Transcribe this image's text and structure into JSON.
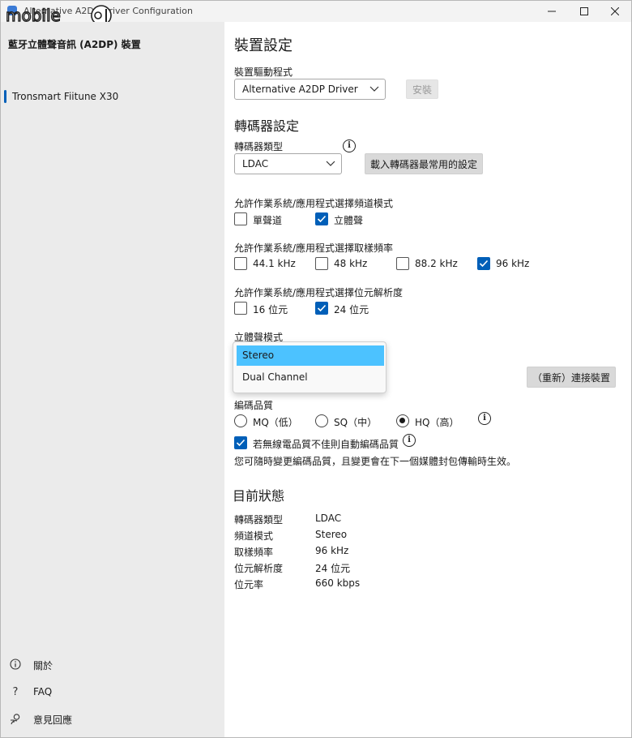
{
  "window": {
    "title": "Alternative A2DP Driver Configuration"
  },
  "sidebar": {
    "title": "藍牙立體聲音訊 (A2DP) 裝置",
    "device": "Tronsmart Fiitune X30",
    "links": [
      {
        "icon": "info-icon",
        "label": "關於"
      },
      {
        "icon": "question-icon",
        "label": "FAQ"
      },
      {
        "icon": "feedback-icon",
        "label": "意見回應"
      }
    ]
  },
  "main": {
    "device_settings_heading": "裝置設定",
    "driver_label": "裝置驅動程式",
    "driver_value": "Alternative A2DP Driver",
    "install_button": "安裝",
    "codec_settings_heading": "轉碼器設定",
    "codec_type_label": "轉碼器類型",
    "codec_type_value": "LDAC",
    "load_common_button": "載入轉碼器最常用的設定",
    "channel_mode_label": "允許作業系統/應用程式選擇頻道模式",
    "channel_options": [
      {
        "label": "單聲道",
        "checked": false
      },
      {
        "label": "立體聲",
        "checked": true
      }
    ],
    "sample_rate_label": "允許作業系統/應用程式選擇取樣頻率",
    "sample_rate_options": [
      {
        "label": "44.1 kHz",
        "checked": false
      },
      {
        "label": "48 kHz",
        "checked": false
      },
      {
        "label": "88.2 kHz",
        "checked": false
      },
      {
        "label": "96 kHz",
        "checked": true
      }
    ],
    "bit_depth_label": "允許作業系統/應用程式選擇位元解析度",
    "bit_depth_options": [
      {
        "label": "16 位元",
        "checked": false
      },
      {
        "label": "24 位元",
        "checked": true
      }
    ],
    "stereo_mode_label": "立體聲模式",
    "stereo_mode_options": [
      "Stereo",
      "Dual Channel"
    ],
    "stereo_mode_selected": "Stereo",
    "reconnect_button": "（重新）連接裝置",
    "quality_label": "編碼品質",
    "quality_options": [
      {
        "label": "MQ（低）",
        "checked": false
      },
      {
        "label": "SQ（中）",
        "checked": false
      },
      {
        "label": "HQ（高）",
        "checked": true
      }
    ],
    "auto_quality_label": "若無線電品質不佳則自動編碼品質",
    "auto_quality_checked": true,
    "quality_note": "您可隨時變更編碼品質，且變更會在下一個媒體封包傳輸時生效。",
    "status_heading": "目前狀態",
    "status": [
      {
        "key": "轉碼器類型",
        "value": "LDAC"
      },
      {
        "key": "頻道模式",
        "value": "Stereo"
      },
      {
        "key": "取樣頻率",
        "value": "96 kHz"
      },
      {
        "key": "位元解析度",
        "value": "24 位元"
      },
      {
        "key": "位元率",
        "value": "660 kbps"
      }
    ]
  },
  "colors": {
    "accent": "#005fb8",
    "dropdown_selected": "#4cc2ff",
    "sidebar_bg": "#ebebeb"
  }
}
